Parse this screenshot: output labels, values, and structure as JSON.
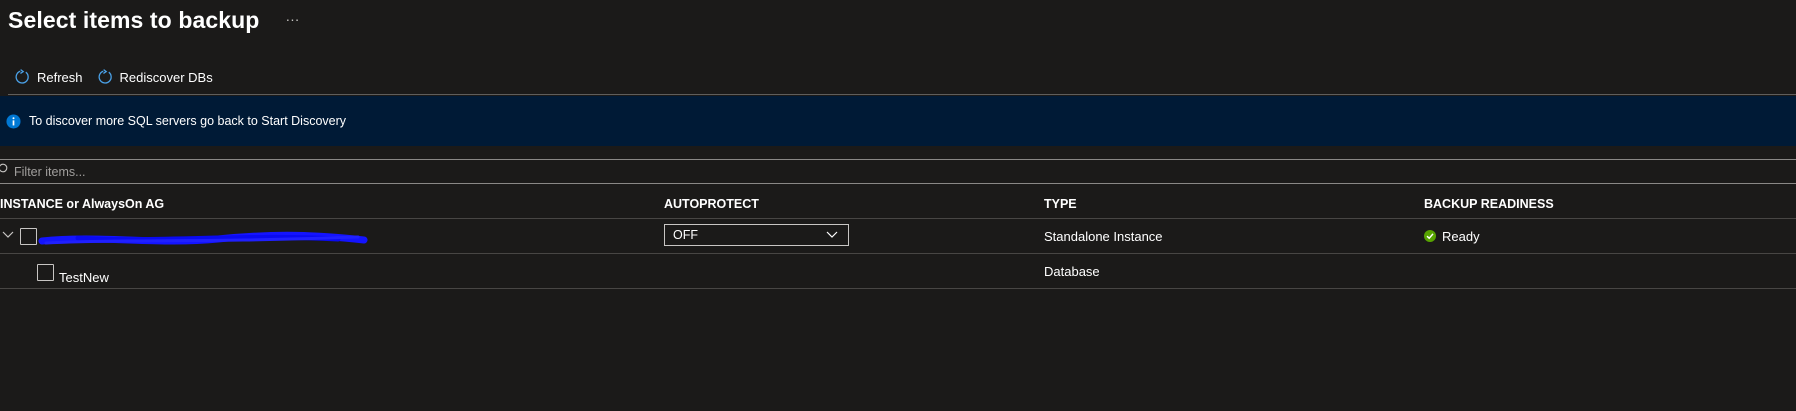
{
  "header": {
    "title": "Select items to backup",
    "more_label": "···"
  },
  "toolbar": {
    "refresh_label": "Refresh",
    "rediscover_label": "Rediscover DBs"
  },
  "banner": {
    "message": "To discover more SQL servers go back to Start Discovery",
    "accent_color": "#0078d4"
  },
  "filter": {
    "placeholder": "Filter items..."
  },
  "grid": {
    "columns": [
      "INSTANCE or AlwaysOn AG",
      "AUTOPROTECT",
      "TYPE",
      "BACKUP READINESS"
    ],
    "rows": [
      {
        "name": "",
        "autoprotect": "OFF",
        "type": "Standalone Instance",
        "readiness": "Ready",
        "readiness_color": "#57a300"
      },
      {
        "name": "TestNew",
        "type": "Database"
      }
    ]
  }
}
